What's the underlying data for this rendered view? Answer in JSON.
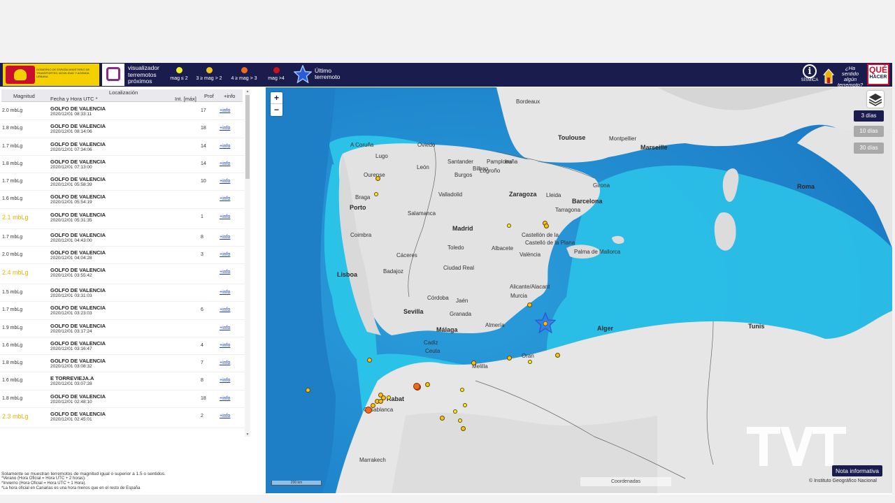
{
  "header": {
    "gov_text": "GOBIERNO DE ESPAÑA  MINISTERIO DE TRANSPORTES, MOVILIDAD Y AGENDA URBANA",
    "visor_title": "visualizador\nterremotos\npróximos",
    "legend": [
      {
        "label": "mag ≤ 2",
        "color": "#f1ee2a"
      },
      {
        "label": "3 ≥ mag > 2",
        "color": "#f2c21a"
      },
      {
        "label": "4 ≥ mag > 3",
        "color": "#ef6b1c"
      },
      {
        "label": "mag >4",
        "color": "#d0101a"
      }
    ],
    "last_eq_label": "Último\nterremoto",
    "sismica_label": "SÍSMICA",
    "felt_label": "¿Ha sentido\nalgún\nterremoto?",
    "que_hacer_top": "QUÉ",
    "que_hacer_bottom": "HACER"
  },
  "list": {
    "columns": {
      "magnitude": "Magnitud",
      "location": "Localización",
      "datetime": "Fecha y Hora UTC *",
      "intensity": "Int. [máx]",
      "depth": "Prof",
      "info": "+info"
    },
    "rows": [
      {
        "mag": "2.0 mbLg",
        "loc": "GOLFO DE VALENCIA",
        "dt": "2020/12/01 08:33:11",
        "prof": "17",
        "info": "+info",
        "hi": false
      },
      {
        "mag": "1.8 mbLg",
        "loc": "GOLFO DE VALENCIA",
        "dt": "2020/12/01 08:14:06",
        "prof": "18",
        "info": "+info",
        "hi": false
      },
      {
        "mag": "1.7 mbLg",
        "loc": "GOLFO DE VALENCIA",
        "dt": "2020/12/01 07:34:06",
        "prof": "14",
        "info": "+info",
        "hi": false
      },
      {
        "mag": "1.8 mbLg",
        "loc": "GOLFO DE VALENCIA",
        "dt": "2020/12/01 07:13:00",
        "prof": "14",
        "info": "+info",
        "hi": false
      },
      {
        "mag": "1.7 mbLg",
        "loc": "GOLFO DE VALENCIA",
        "dt": "2020/12/01 05:58:39",
        "prof": "10",
        "info": "+info",
        "hi": false
      },
      {
        "mag": "1.6 mbLg",
        "loc": "GOLFO DE VALENCIA",
        "dt": "2020/12/01 05:54:19",
        "prof": "",
        "info": "+info",
        "hi": false
      },
      {
        "mag": "2.1 mbLg",
        "loc": "GOLFO DE VALENCIA",
        "dt": "2020/12/01 05:31:35",
        "prof": "1",
        "info": "+info",
        "hi": true
      },
      {
        "mag": "1.7 mbLg",
        "loc": "GOLFO DE VALENCIA",
        "dt": "2020/12/01 04:43:00",
        "prof": "8",
        "info": "+info",
        "hi": false
      },
      {
        "mag": "2.0 mbLg",
        "loc": "GOLFO DE VALENCIA",
        "dt": "2020/12/01 04:04:28",
        "prof": "3",
        "info": "+info",
        "hi": false
      },
      {
        "mag": "2.4 mbLg",
        "loc": "GOLFO DE VALENCIA",
        "dt": "2020/12/01 03:55:42",
        "prof": "",
        "info": "+info",
        "hi": true
      },
      {
        "mag": "1.5 mbLg",
        "loc": "GOLFO DE VALENCIA",
        "dt": "2020/12/01 03:31:03",
        "prof": "",
        "info": "+info",
        "hi": false
      },
      {
        "mag": "1.7 mbLg",
        "loc": "GOLFO DE VALENCIA",
        "dt": "2020/12/01 03:23:03",
        "prof": "6",
        "info": "+info",
        "hi": false
      },
      {
        "mag": "1.9 mbLg",
        "loc": "GOLFO DE VALENCIA",
        "dt": "2020/12/01 03:17:24",
        "prof": "",
        "info": "+info",
        "hi": false
      },
      {
        "mag": "1.6 mbLg",
        "loc": "GOLFO DE VALENCIA",
        "dt": "2020/12/01 03:16:47",
        "prof": "4",
        "info": "+info",
        "hi": false
      },
      {
        "mag": "1.8 mbLg",
        "loc": "GOLFO DE VALENCIA",
        "dt": "2020/12/01 03:08:32",
        "prof": "7",
        "info": "+info",
        "hi": false
      },
      {
        "mag": "1.6 mbLg",
        "loc": "E TORREVIEJA.A",
        "dt": "2020/12/01 03:07:28",
        "prof": "8",
        "info": "+info",
        "hi": false
      },
      {
        "mag": "1.8 mbLg",
        "loc": "GOLFO DE VALENCIA",
        "dt": "2020/12/01 02:48:10",
        "prof": "18",
        "info": "+info",
        "hi": false
      },
      {
        "mag": "2.3 mbLg",
        "loc": "GOLFO DE VALENCIA",
        "dt": "2020/12/01 02:45:01",
        "prof": "2",
        "info": "+info",
        "hi": true
      }
    ],
    "notes": [
      "Solamente se muestran terremotos de magnitud igual o superior a 1.5 o sentidos.",
      "*Verano (Hora Oficial = Hora UTC + 2 horas).",
      "*Invierno (Hora Oficial = Hora UTC + 1 Hora).",
      "*La hora oficial en Canarias es una hora menos que en el resto de España"
    ]
  },
  "map": {
    "zoom_in": "+",
    "zoom_out": "−",
    "range_buttons": [
      "3 días",
      "10 días",
      "30 días"
    ],
    "coords_label": "Coordenadas",
    "scale_label": "200 km",
    "attribution": "© Instituto Geográfico Nacional",
    "nota_label": "Nota informativa",
    "watermark": "TVT",
    "cities": [
      {
        "name": "Bordeaux",
        "big": false
      },
      {
        "name": "Toulouse",
        "big": true
      },
      {
        "name": "Montpellier",
        "big": false
      },
      {
        "name": "Marseille",
        "big": true
      },
      {
        "name": "A Coruña",
        "big": false
      },
      {
        "name": "Oviedo",
        "big": false
      },
      {
        "name": "Santander",
        "big": false
      },
      {
        "name": "Bilbao",
        "big": false
      },
      {
        "name": "Lugo",
        "big": false
      },
      {
        "name": "Pamplona",
        "big": false
      },
      {
        "name": "Iruña",
        "big": false
      },
      {
        "name": "Logroño",
        "big": false
      },
      {
        "name": "León",
        "big": false
      },
      {
        "name": "Burgos",
        "big": false
      },
      {
        "name": "Ourense",
        "big": false
      },
      {
        "name": "Zaragoza",
        "big": true
      },
      {
        "name": "Lleida",
        "big": false
      },
      {
        "name": "Girona",
        "big": false
      },
      {
        "name": "Valladolid",
        "big": false
      },
      {
        "name": "Braga",
        "big": false
      },
      {
        "name": "Barcelona",
        "big": true
      },
      {
        "name": "Tarragona",
        "big": false
      },
      {
        "name": "Porto",
        "big": true
      },
      {
        "name": "Salamanca",
        "big": false
      },
      {
        "name": "Roma",
        "big": true
      },
      {
        "name": "Madrid",
        "big": true
      },
      {
        "name": "Castellón de la",
        "big": false
      },
      {
        "name": "Castelló de la Plana",
        "big": false
      },
      {
        "name": "Coimbra",
        "big": false
      },
      {
        "name": "Toledo",
        "big": false
      },
      {
        "name": "Palma de Mallorca",
        "big": false
      },
      {
        "name": "Cáceres",
        "big": false
      },
      {
        "name": "València",
        "big": false
      },
      {
        "name": "Ciudad Real",
        "big": false
      },
      {
        "name": "Albacete",
        "big": false
      },
      {
        "name": "Lisboa",
        "big": true
      },
      {
        "name": "Badajoz",
        "big": false
      },
      {
        "name": "Alicante/Alacant",
        "big": false
      },
      {
        "name": "Murcia",
        "big": false
      },
      {
        "name": "Córdoba",
        "big": false
      },
      {
        "name": "Sevilla",
        "big": true
      },
      {
        "name": "Jaén",
        "big": false
      },
      {
        "name": "Granada",
        "big": false
      },
      {
        "name": "Almería",
        "big": false
      },
      {
        "name": "Málaga",
        "big": true
      },
      {
        "name": "Alger",
        "big": true
      },
      {
        "name": "Tunis",
        "big": true
      },
      {
        "name": "Cadiz",
        "big": false
      },
      {
        "name": "Ceuta",
        "big": false
      },
      {
        "name": "Melilla",
        "big": false
      },
      {
        "name": "Oran",
        "big": false
      },
      {
        "name": "Rabat",
        "big": true
      },
      {
        "name": "Casablanca",
        "big": false
      },
      {
        "name": "Marrakech",
        "big": false
      }
    ]
  }
}
